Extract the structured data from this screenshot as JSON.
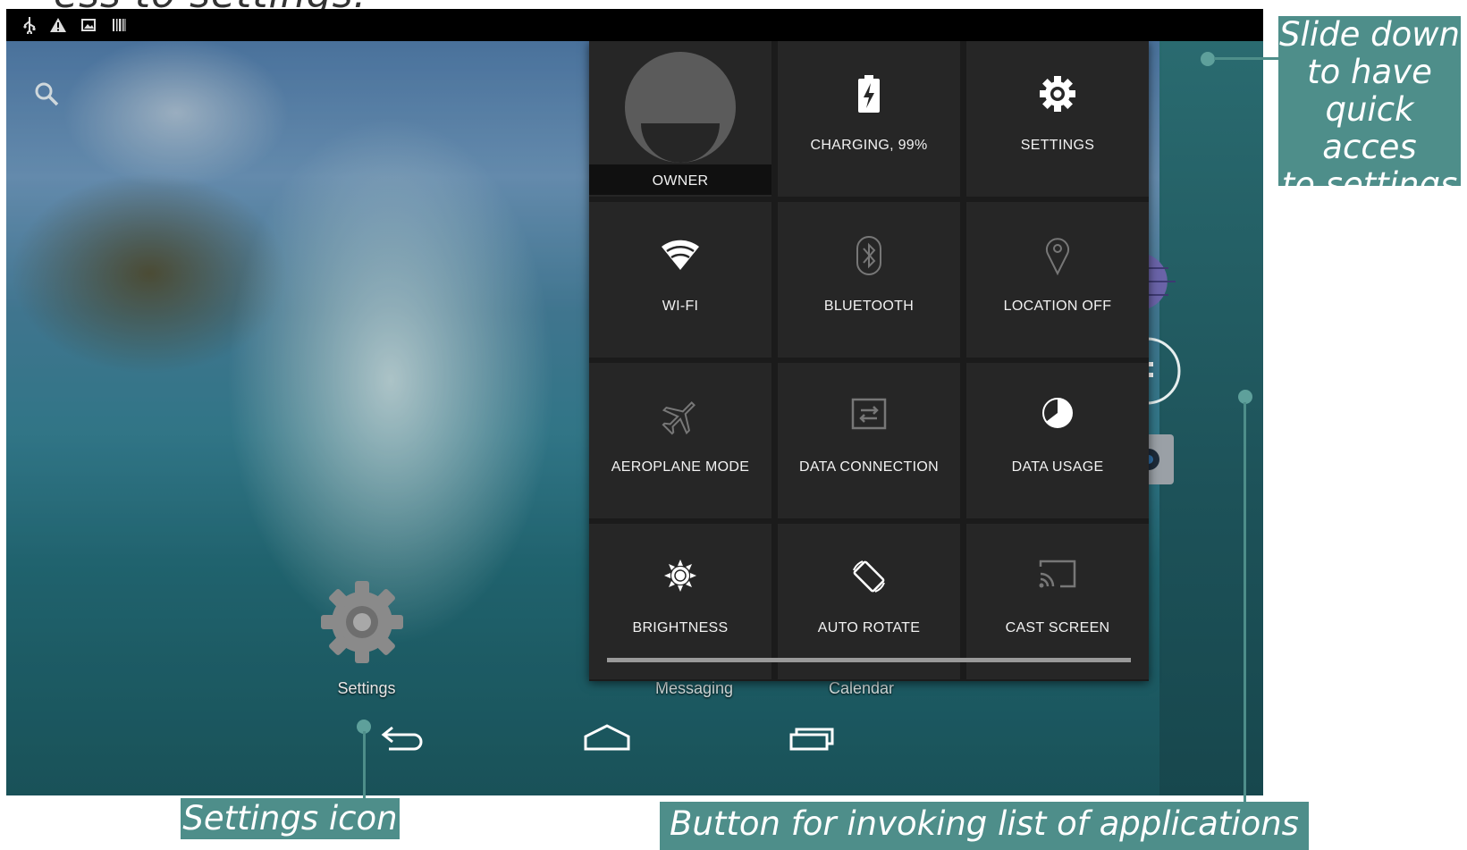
{
  "page": {
    "heading": "ess to settings:"
  },
  "statusbar": {
    "icons": [
      "usb-icon",
      "warning-icon",
      "image-icon",
      "barcode-icon"
    ]
  },
  "desktop": {
    "settings_icon_label": "Settings",
    "dock_labels": [
      "Messaging",
      "Calendar"
    ]
  },
  "quick_settings": {
    "tiles": [
      {
        "label": "OWNER",
        "icon": "user-avatar"
      },
      {
        "label": "CHARGING, 99%",
        "icon": "battery-charging-icon"
      },
      {
        "label": "SETTINGS",
        "icon": "gear-icon"
      },
      {
        "label": "WI-FI",
        "icon": "wifi-icon"
      },
      {
        "label": "BLUETOOTH",
        "icon": "bluetooth-icon"
      },
      {
        "label": "LOCATION OFF",
        "icon": "location-icon"
      },
      {
        "label": "AEROPLANE MODE",
        "icon": "airplane-icon"
      },
      {
        "label": "DATA CONNECTION",
        "icon": "data-connection-icon"
      },
      {
        "label": "DATA USAGE",
        "icon": "data-usage-icon"
      },
      {
        "label": "BRIGHTNESS",
        "icon": "brightness-icon"
      },
      {
        "label": "AUTO ROTATE",
        "icon": "auto-rotate-icon"
      },
      {
        "label": "CAST SCREEN",
        "icon": "cast-icon"
      }
    ]
  },
  "navbar": {
    "buttons": [
      "back-icon",
      "home-icon",
      "recents-icon"
    ]
  },
  "callouts": {
    "top": "Slide down to have quick acces to settings",
    "top_lines": [
      "Slide down",
      "to have",
      "quick acces",
      "to settings"
    ],
    "settings": "Settings icon",
    "apps": "Button for invoking list of applications"
  },
  "colors": {
    "callout_bg": "#4e8e8a",
    "panel_bg": "#1b1b1b",
    "tile_bg": "#262626"
  }
}
